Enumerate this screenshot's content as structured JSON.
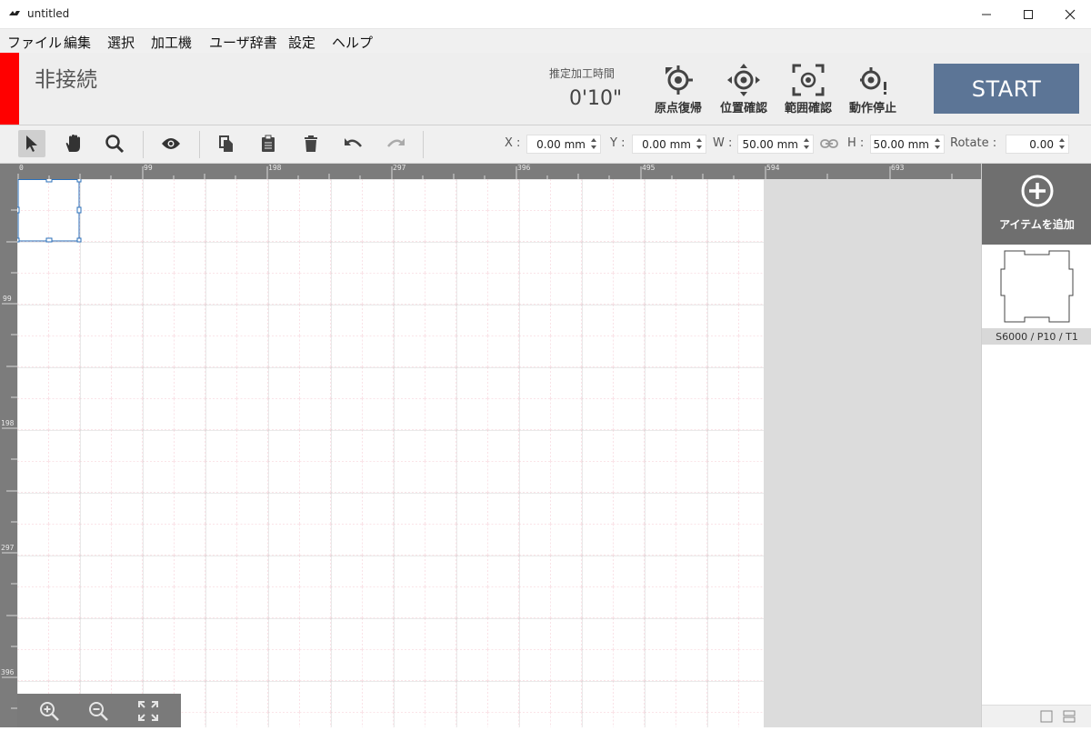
{
  "window": {
    "title": "untitled"
  },
  "menu": [
    "ファイル",
    "編集",
    "選択",
    "加工機",
    "ユーザ辞書",
    "設定",
    "ヘルプ"
  ],
  "header": {
    "connection_status": "非接続",
    "estimate_label": "推定加工時間",
    "estimate_value": "0'10\"",
    "buttons": [
      {
        "label": "原点復帰",
        "icon": "home-target-icon"
      },
      {
        "label": "位置確認",
        "icon": "position-check-icon"
      },
      {
        "label": "範囲確認",
        "icon": "range-check-icon"
      },
      {
        "label": "動作停止",
        "icon": "stop-motion-icon"
      }
    ],
    "start_label": "START",
    "status_color": "#ff0000",
    "start_color": "#5c7596"
  },
  "toolbar": {
    "x_label": "X :",
    "x_value": "0.00 mm",
    "y_label": "Y :",
    "y_value": "0.00 mm",
    "w_label": "W :",
    "w_value": "50.00 mm",
    "h_label": "H :",
    "h_value": "50.00 mm",
    "rotate_label": "Rotate :",
    "rotate_value": "0.00",
    "tools": [
      "select-tool-icon",
      "hand-tool-icon",
      "zoom-tool-icon",
      "preview-eye-icon",
      "copy-icon",
      "paste-icon",
      "delete-icon",
      "undo-icon",
      "redo-icon"
    ]
  },
  "rulers": {
    "top": [
      "0",
      "99",
      "198",
      "297",
      "396",
      "495",
      "594",
      "693"
    ],
    "left": [
      "99",
      "198",
      "297",
      "396"
    ]
  },
  "sidebar": {
    "add_item_label": "アイテムを追加",
    "items": [
      {
        "label": "S6000 / P10 / T1"
      }
    ]
  }
}
